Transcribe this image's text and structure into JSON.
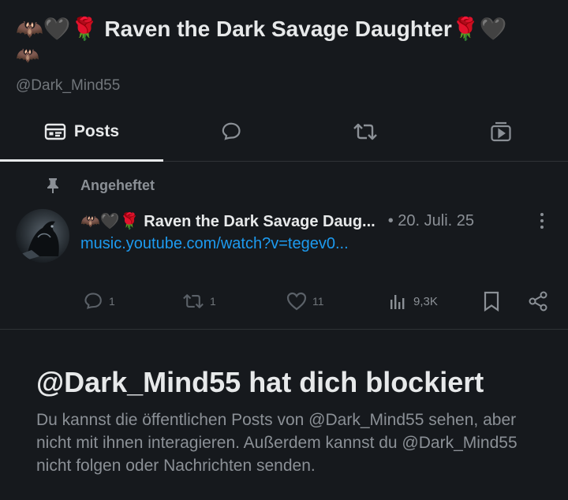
{
  "profile": {
    "display_name_line1": "🦇🖤🌹 Raven the Dark Savage Daughter🌹🖤",
    "display_name_line2": "🦇",
    "handle": "@Dark_Mind55"
  },
  "tabs": [
    {
      "label": "Posts",
      "icon": "posts-icon",
      "active": true
    },
    {
      "label": "",
      "icon": "replies-icon"
    },
    {
      "label": "",
      "icon": "repost-icon"
    },
    {
      "label": "",
      "icon": "media-icon"
    }
  ],
  "pinned_post": {
    "pinned_label": "Angeheftet",
    "author": "🦇🖤🌹 Raven the Dark Savage Daug...",
    "date": "• 20. Juli. 25",
    "link": "music.youtube.com/watch?v=tegev0...",
    "replies": "1",
    "reposts": "1",
    "likes": "11",
    "views": "9,3K"
  },
  "blocked": {
    "title": "@Dark_Mind55 hat dich blockiert",
    "text": "Du kannst die öffentlichen Posts von @Dark_Mind55 sehen, aber nicht mit ihnen interagieren. Außerdem kannst du @Dark_Mind55 nicht folgen oder Nachrichten senden."
  },
  "colors": {
    "background": "#16191d",
    "link": "#1d9bf0",
    "muted": "#71767b"
  }
}
